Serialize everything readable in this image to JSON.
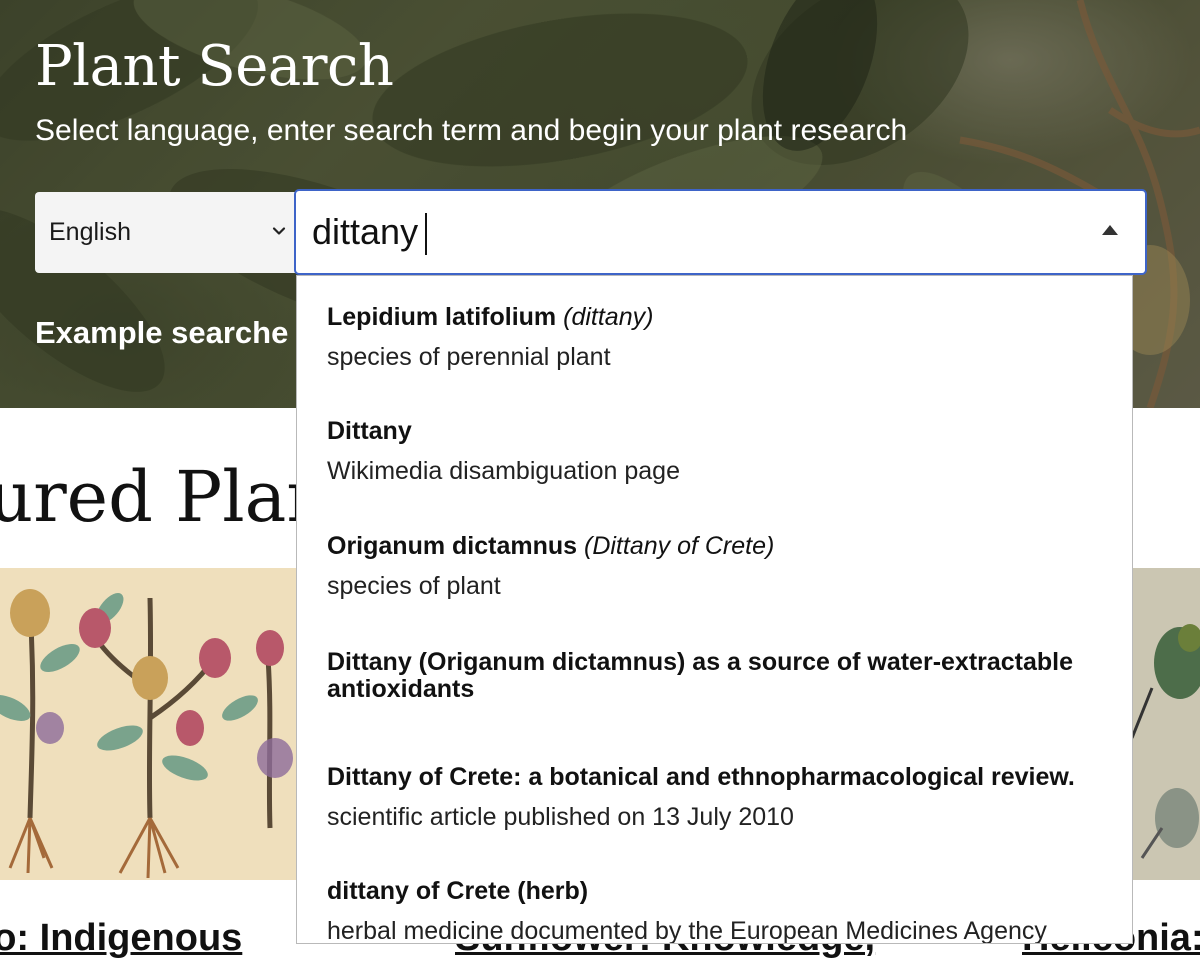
{
  "header": {
    "title": "Plant Search",
    "subtitle": "Select language, enter search term and begin your plant research"
  },
  "language_select": {
    "selected": "English"
  },
  "search": {
    "value": "dittany"
  },
  "example_searches": {
    "label": "Example searche"
  },
  "featured": {
    "heading": "tured Plar",
    "card_titles": [
      "no: Indigenous",
      "Sunflower: Knowledge,",
      "Heliconia:"
    ]
  },
  "dropdown": {
    "items": [
      {
        "title": "Lepidium latifolium",
        "alias": "(dittany)",
        "description": "species of perennial plant"
      },
      {
        "title": "Dittany",
        "alias": "",
        "description": "Wikimedia disambiguation page"
      },
      {
        "title": "Origanum dictamnus",
        "alias": "(Dittany of Crete)",
        "description": "species of plant"
      },
      {
        "title": "Dittany (Origanum dictamnus) as a source of water-extractable antioxidants",
        "alias": "",
        "description": ""
      },
      {
        "title": "Dittany of Crete: a botanical and ethnopharmacological review.",
        "alias": "",
        "description": "scientific article published on 13 July 2010"
      },
      {
        "title": "dittany of Crete (herb)",
        "alias": "",
        "description": "herbal medicine documented by the European Medicines Agency"
      }
    ]
  },
  "icons": {
    "language_chevron": "chevron-down-icon",
    "dropdown_toggle": "triangle-up-icon"
  },
  "colors": {
    "search_border": "#3e64c8",
    "hero_text": "#ffffff"
  }
}
